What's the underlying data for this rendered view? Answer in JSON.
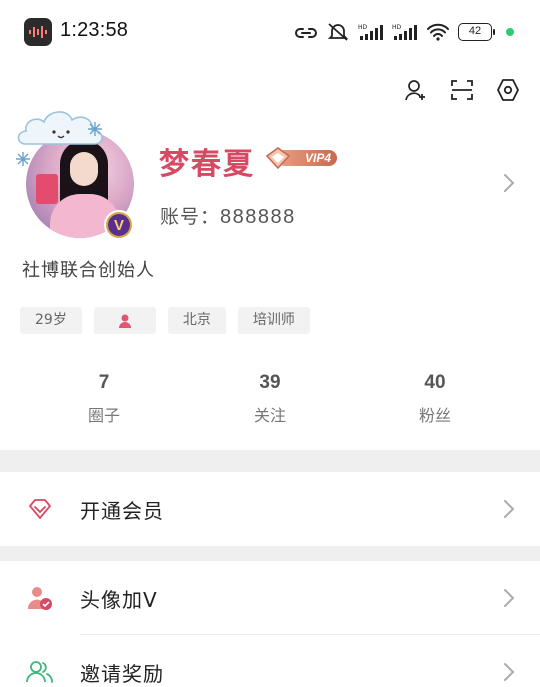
{
  "status_bar": {
    "time": "1:23:58",
    "battery": "42",
    "network": "HD"
  },
  "top_actions": {
    "icons": [
      "add-friend-icon",
      "scan-icon",
      "settings-icon"
    ]
  },
  "profile": {
    "name": "梦春夏",
    "vip_level": "VIP4",
    "account_label": "账号：",
    "account_number": "888888",
    "bio": "社博联合创始人",
    "avatar_badge": "V",
    "tags": {
      "age": "29岁",
      "city": "北京",
      "role": "培训师"
    }
  },
  "stats": [
    {
      "value": "7",
      "label": "圈子"
    },
    {
      "value": "39",
      "label": "关注"
    },
    {
      "value": "40",
      "label": "粉丝"
    }
  ],
  "menu": {
    "membership": "开通会员",
    "avatar_v": "头像加V",
    "invite": "邀请奖励"
  },
  "colors": {
    "brand_pink": "#d64a63",
    "vip_orange": "#c66a4e",
    "invite_green": "#3cb878",
    "badge_purple": "#5a2f8a"
  }
}
